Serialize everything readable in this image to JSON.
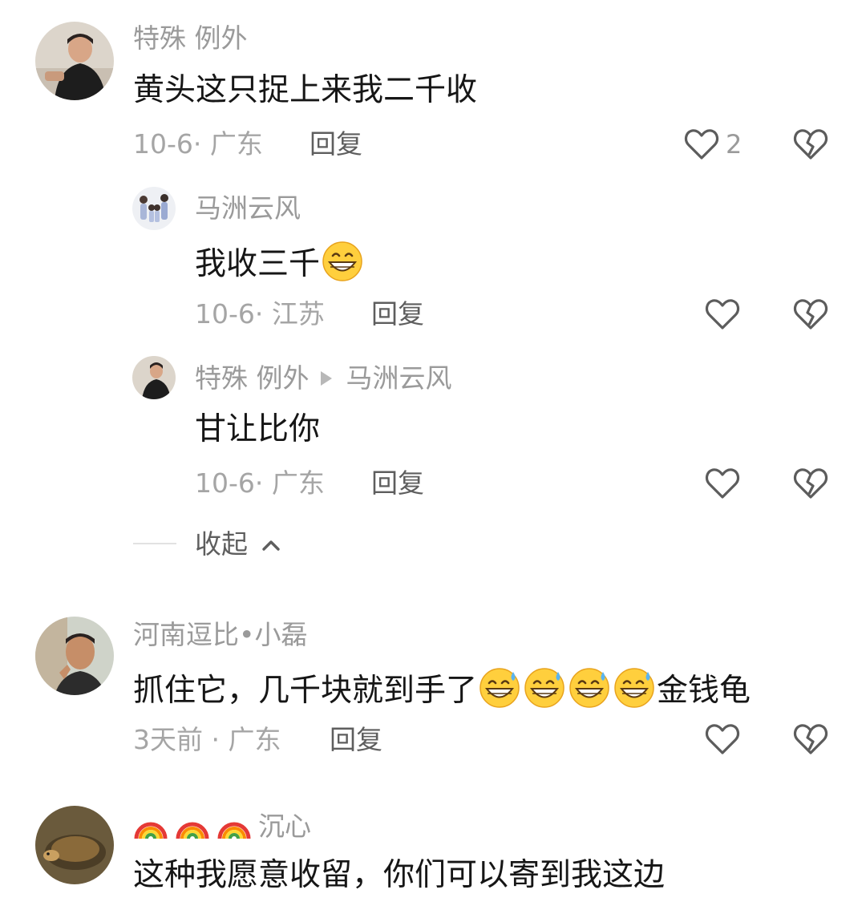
{
  "comments": [
    {
      "user": "特殊 例外",
      "text": "黄头这只捉上来我二千收",
      "date": "10-6·",
      "location": "广东",
      "reply_label": "回复",
      "likes": "2",
      "avatar_icon": "man-avatar-icon",
      "replies": [
        {
          "user": "马洲云风",
          "text": "我收三千",
          "emoji_after": [
            "grinning-face-emoji"
          ],
          "date": "10-6·",
          "location": "江苏",
          "reply_label": "回复",
          "avatar_icon": "family-avatar-icon"
        },
        {
          "user": "特殊 例外",
          "reply_to": "马洲云风",
          "text": "甘让比你",
          "date": "10-6·",
          "location": "广东",
          "reply_label": "回复",
          "avatar_icon": "man-avatar-icon"
        }
      ],
      "collapse_label": "收起"
    },
    {
      "user": "河南逗比•小磊",
      "text": "抓住它，几千块就到手了",
      "emoji_after": [
        "grinning-sweat-emoji",
        "grinning-sweat-emoji",
        "grinning-sweat-emoji",
        "grinning-sweat-emoji"
      ],
      "text_tail": "金钱龟",
      "date": "3天前 ·",
      "location": "广东",
      "reply_label": "回复",
      "avatar_icon": "man-selfie-avatar-icon"
    },
    {
      "user_prefix_emoji": [
        "rainbow-emoji",
        "rainbow-emoji",
        "rainbow-emoji"
      ],
      "user": "沉心",
      "text": "这种我愿意收留，你们可以寄到我这边",
      "avatar_icon": "turtle-avatar-icon"
    }
  ],
  "colors": {
    "username": "#9a9a9a",
    "text": "#161616",
    "meta": "#a5a5a5",
    "reply": "#5e5e5e",
    "icon": "#5c5c5c"
  }
}
